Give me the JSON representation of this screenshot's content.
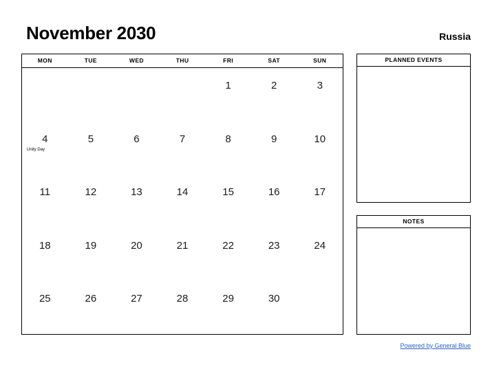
{
  "header": {
    "title": "November 2030",
    "country": "Russia"
  },
  "calendar": {
    "weekday_headers": [
      "MON",
      "TUE",
      "WED",
      "THU",
      "FRI",
      "SAT",
      "SUN"
    ],
    "weeks": [
      [
        {
          "day": "",
          "event": ""
        },
        {
          "day": "",
          "event": ""
        },
        {
          "day": "",
          "event": ""
        },
        {
          "day": "",
          "event": ""
        },
        {
          "day": "1",
          "event": ""
        },
        {
          "day": "2",
          "event": ""
        },
        {
          "day": "3",
          "event": ""
        }
      ],
      [
        {
          "day": "4",
          "event": "Unity Day"
        },
        {
          "day": "5",
          "event": ""
        },
        {
          "day": "6",
          "event": ""
        },
        {
          "day": "7",
          "event": ""
        },
        {
          "day": "8",
          "event": ""
        },
        {
          "day": "9",
          "event": ""
        },
        {
          "day": "10",
          "event": ""
        }
      ],
      [
        {
          "day": "11",
          "event": ""
        },
        {
          "day": "12",
          "event": ""
        },
        {
          "day": "13",
          "event": ""
        },
        {
          "day": "14",
          "event": ""
        },
        {
          "day": "15",
          "event": ""
        },
        {
          "day": "16",
          "event": ""
        },
        {
          "day": "17",
          "event": ""
        }
      ],
      [
        {
          "day": "18",
          "event": ""
        },
        {
          "day": "19",
          "event": ""
        },
        {
          "day": "20",
          "event": ""
        },
        {
          "day": "21",
          "event": ""
        },
        {
          "day": "22",
          "event": ""
        },
        {
          "day": "23",
          "event": ""
        },
        {
          "day": "24",
          "event": ""
        }
      ],
      [
        {
          "day": "25",
          "event": ""
        },
        {
          "day": "26",
          "event": ""
        },
        {
          "day": "27",
          "event": ""
        },
        {
          "day": "28",
          "event": ""
        },
        {
          "day": "29",
          "event": ""
        },
        {
          "day": "30",
          "event": ""
        },
        {
          "day": "",
          "event": ""
        }
      ]
    ]
  },
  "panels": {
    "planned_events": {
      "title": "PLANNED EVENTS",
      "content": ""
    },
    "notes": {
      "title": "NOTES",
      "content": ""
    }
  },
  "footer": {
    "link_text": "Powered by General Blue",
    "link_color": "#2b62c7"
  }
}
